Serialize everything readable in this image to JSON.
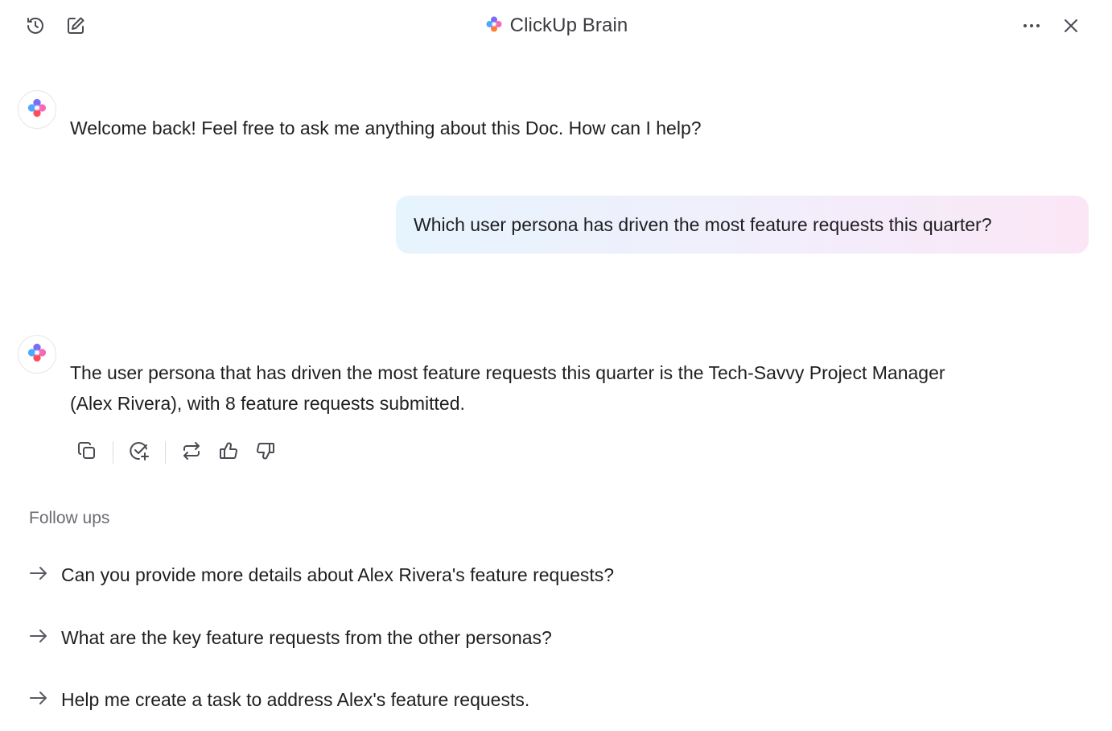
{
  "header": {
    "title": "ClickUp Brain",
    "left_icons": [
      "history-icon",
      "new-chat-icon"
    ],
    "right_icons": [
      "more-options-icon",
      "close-icon"
    ]
  },
  "messages": {
    "welcome": "Welcome back! Feel free to ask me anything about this Doc. How can I help?",
    "user_question": "Which user persona has driven the most feature requests this quarter?",
    "answer_line1": "The user persona that has driven the most feature requests this quarter is the Tech-Savvy Project Manager",
    "answer_line2": "(Alex Rivera), with 8 feature requests submitted."
  },
  "actions": [
    "copy-icon",
    "create-task-icon",
    "regenerate-icon",
    "thumbs-up-icon",
    "thumbs-down-icon"
  ],
  "followups": {
    "label": "Follow ups",
    "items": [
      "Can you provide more details about Alex Rivera's feature requests?",
      "What are the key feature requests from the other personas?",
      "Help me create a task to address Alex's feature requests."
    ]
  },
  "colors": {
    "text": "#1f1f22",
    "muted": "#6b6b72",
    "icon": "#4a4a52",
    "bubble_start": "#e6f4fd",
    "bubble_end": "#fbe6f6"
  }
}
